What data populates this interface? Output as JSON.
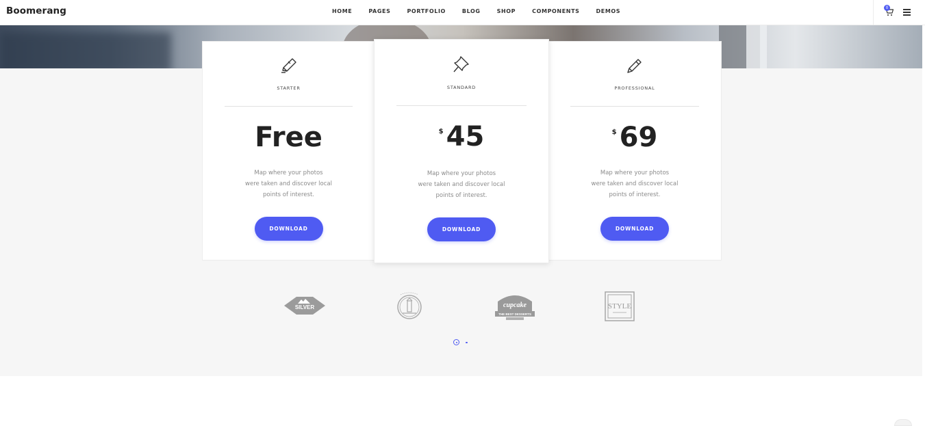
{
  "header": {
    "brand": "Boomerang",
    "nav": [
      "HOME",
      "PAGES",
      "PORTFOLIO",
      "BLOG",
      "SHOP",
      "COMPONENTS",
      "DEMOS"
    ],
    "cart_count": "0"
  },
  "pricing": [
    {
      "icon": "pen-nib-icon",
      "plan": "STARTER",
      "currency": "",
      "price": "Free",
      "desc": [
        "Map where your photos",
        "were taken and discover local",
        "points of interest."
      ],
      "button": "DOWNLOAD"
    },
    {
      "icon": "pushpin-icon",
      "plan": "STANDARD",
      "currency": "$",
      "price": "45",
      "desc": [
        "Map where your photos",
        "were taken and discover local",
        "points of interest."
      ],
      "button": "DOWNLOAD"
    },
    {
      "icon": "pencil-icon",
      "plan": "PROFESSIONAL",
      "currency": "$",
      "price": "69",
      "desc": [
        "Map where your photos",
        "were taken and discover local",
        "points of interest."
      ],
      "button": "DOWNLOAD"
    }
  ],
  "logos": [
    {
      "name": "silver-logo",
      "text": "SILVER"
    },
    {
      "name": "lighthouse-logo",
      "text": "THE LIGHTHOUSE"
    },
    {
      "name": "cupcake-logo",
      "text": "cupcake",
      "sub": "THE BEST DESSERTS"
    },
    {
      "name": "style-logo",
      "text": "STYLE"
    }
  ],
  "colors": {
    "accent": "#4f5bf2",
    "section_bg": "#f6f6f6",
    "card_bg": "#ffffff"
  },
  "carousel": {
    "pages": 2,
    "active": 1
  }
}
